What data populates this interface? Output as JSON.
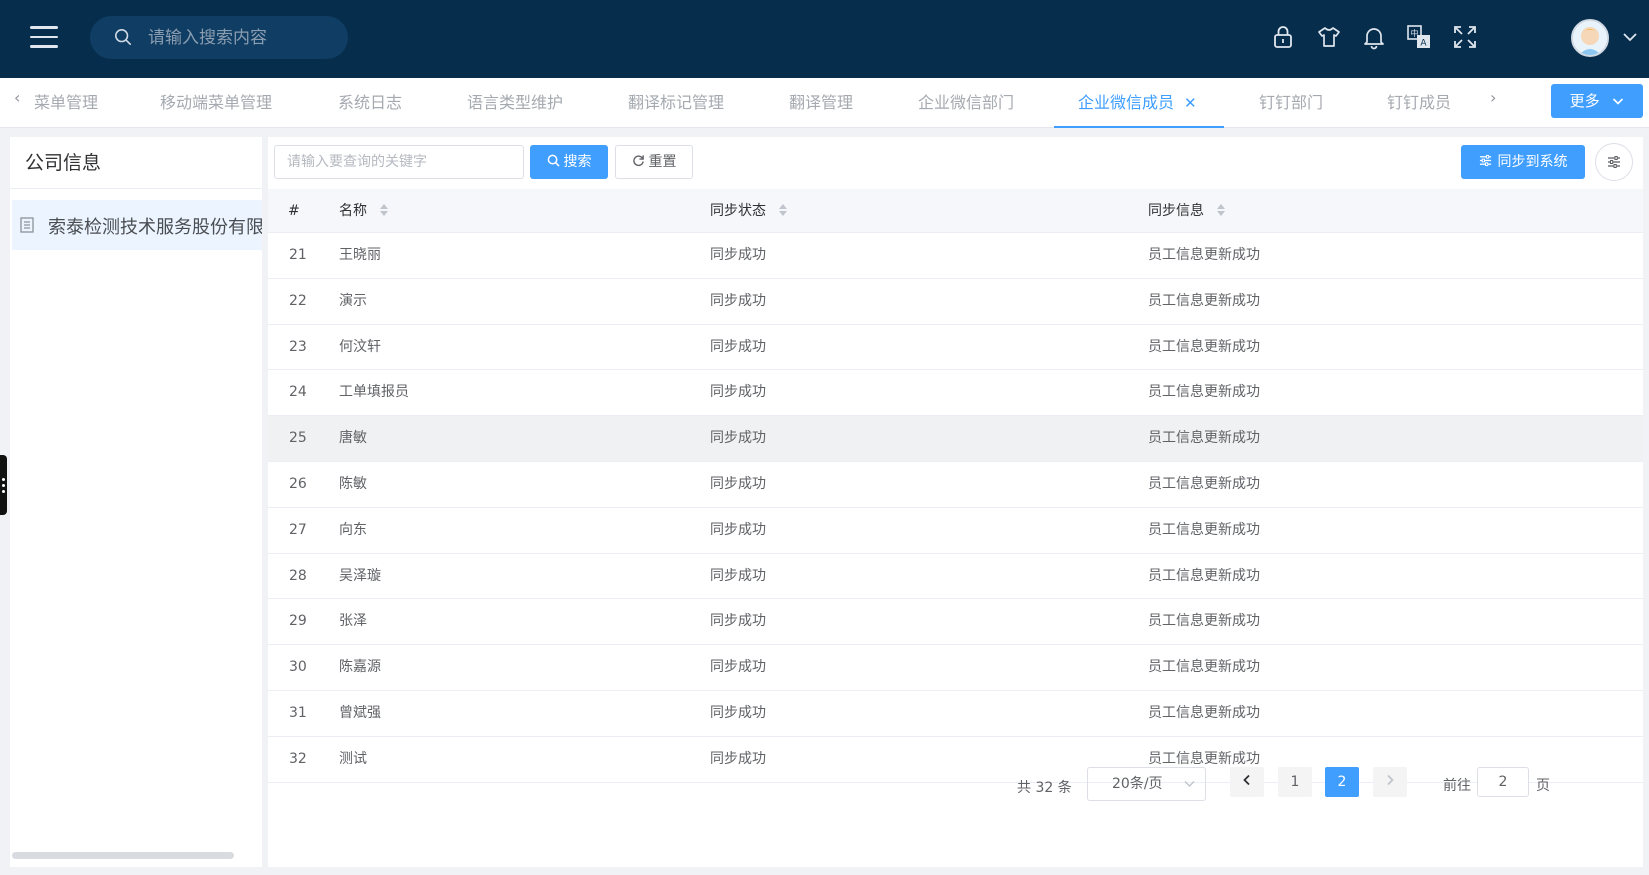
{
  "header": {
    "search_placeholder": "请输入搜索内容",
    "icons": [
      "lock-icon",
      "tshirt-icon",
      "bell-icon",
      "translate-icon",
      "fullscreen-icon"
    ]
  },
  "tabs": [
    {
      "label": "菜单管理",
      "active": false
    },
    {
      "label": "移动端菜单管理",
      "active": false
    },
    {
      "label": "系统日志",
      "active": false
    },
    {
      "label": "语言类型维护",
      "active": false
    },
    {
      "label": "翻译标记管理",
      "active": false
    },
    {
      "label": "翻译管理",
      "active": false
    },
    {
      "label": "企业微信部门",
      "active": false
    },
    {
      "label": "企业微信成员",
      "active": true
    },
    {
      "label": "钉钉部门",
      "active": false
    },
    {
      "label": "钉钉成员",
      "active": false
    }
  ],
  "tab_more": "更多",
  "left_panel": {
    "title": "公司信息",
    "tree_item": "索泰检测技术服务股份有限公司"
  },
  "toolbar": {
    "keyword_placeholder": "请输入要查询的关键字",
    "search_label": "搜索",
    "reset_label": "重置",
    "sync_label": "同步到系统"
  },
  "table": {
    "columns": [
      "#",
      "名称",
      "同步状态",
      "同步信息"
    ],
    "rows": [
      {
        "idx": "21",
        "name": "王晓丽",
        "status": "同步成功",
        "info": "员工信息更新成功"
      },
      {
        "idx": "22",
        "name": "演示",
        "status": "同步成功",
        "info": "员工信息更新成功"
      },
      {
        "idx": "23",
        "name": "何汶轩",
        "status": "同步成功",
        "info": "员工信息更新成功"
      },
      {
        "idx": "24",
        "name": "工单填报员",
        "status": "同步成功",
        "info": "员工信息更新成功"
      },
      {
        "idx": "25",
        "name": "唐敏",
        "status": "同步成功",
        "info": "员工信息更新成功"
      },
      {
        "idx": "26",
        "name": "陈敏",
        "status": "同步成功",
        "info": "员工信息更新成功"
      },
      {
        "idx": "27",
        "name": "向东",
        "status": "同步成功",
        "info": "员工信息更新成功"
      },
      {
        "idx": "28",
        "name": "吴泽璇",
        "status": "同步成功",
        "info": "员工信息更新成功"
      },
      {
        "idx": "29",
        "name": "张泽",
        "status": "同步成功",
        "info": "员工信息更新成功"
      },
      {
        "idx": "30",
        "name": "陈嘉源",
        "status": "同步成功",
        "info": "员工信息更新成功"
      },
      {
        "idx": "31",
        "name": "曾斌强",
        "status": "同步成功",
        "info": "员工信息更新成功"
      },
      {
        "idx": "32",
        "name": "测试",
        "status": "同步成功",
        "info": "员工信息更新成功"
      }
    ]
  },
  "pagination": {
    "total": "共 32 条",
    "page_size": "20条/页",
    "pages": [
      "1",
      "2"
    ],
    "current": "2",
    "goto_prefix": "前往",
    "goto_value": "2",
    "goto_suffix": "页"
  },
  "colors": {
    "header_bg": "#072d4c",
    "primary": "#409eff"
  }
}
